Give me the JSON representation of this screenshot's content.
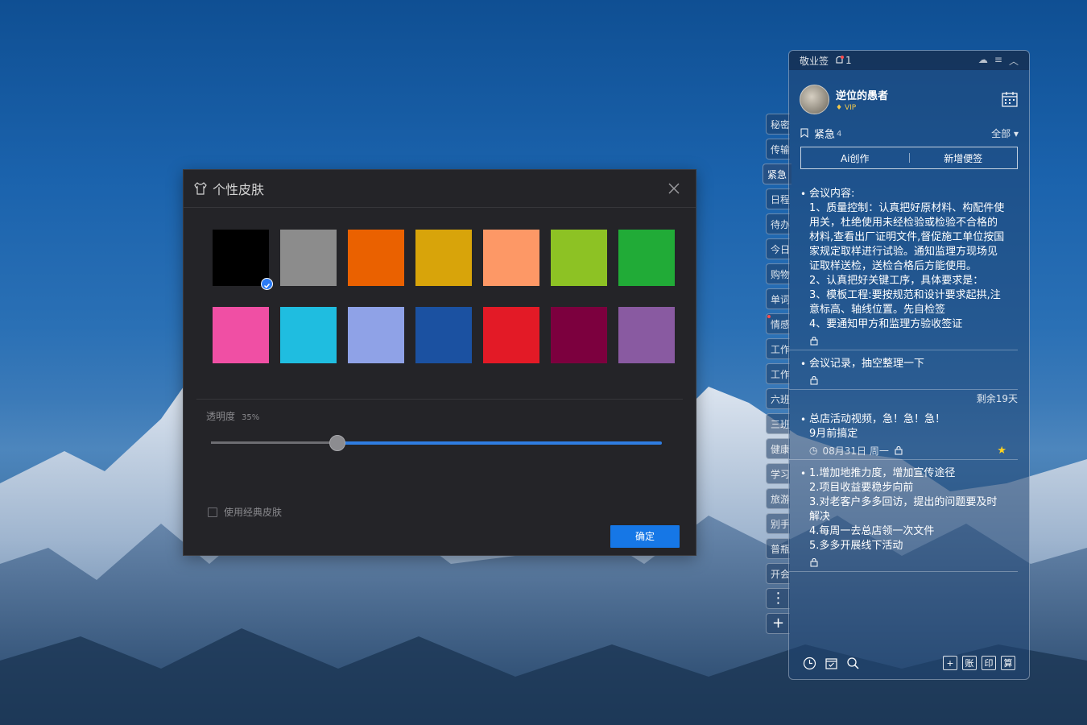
{
  "side_tabs": [
    {
      "label": "秘密",
      "active": false,
      "dot": false
    },
    {
      "label": "传输",
      "active": false,
      "dot": false
    },
    {
      "label": "紧急",
      "active": true,
      "dot": false
    },
    {
      "label": "日程",
      "active": false,
      "dot": false
    },
    {
      "label": "待办",
      "active": false,
      "dot": false
    },
    {
      "label": "今日",
      "active": false,
      "dot": false
    },
    {
      "label": "购物",
      "active": false,
      "dot": false
    },
    {
      "label": "单词",
      "active": false,
      "dot": false
    },
    {
      "label": "情感",
      "active": false,
      "dot": true
    },
    {
      "label": "工作",
      "active": false,
      "dot": false
    },
    {
      "label": "工作",
      "active": false,
      "dot": false
    },
    {
      "label": "六班",
      "active": false,
      "dot": false
    },
    {
      "label": "三班",
      "active": false,
      "dot": false
    },
    {
      "label": "健康",
      "active": false,
      "dot": false
    },
    {
      "label": "学习",
      "active": false,
      "dot": false
    },
    {
      "label": "旅游",
      "active": false,
      "dot": false
    },
    {
      "label": "别手",
      "active": false,
      "dot": false
    },
    {
      "label": "普瓶",
      "active": false,
      "dot": false
    },
    {
      "label": "开会",
      "active": false,
      "dot": false
    }
  ],
  "side_buttons": {
    "more": "⋮",
    "add": "+"
  },
  "panel": {
    "app_name": "敬业签",
    "bell_count": "1",
    "user": {
      "name": "逆位的愚者",
      "vip": "VIP"
    },
    "filter": {
      "label": "紧急",
      "count": "4",
      "all": "全部"
    },
    "actions": {
      "ai": "Ai创作",
      "new": "新增便签"
    },
    "notes": [
      {
        "text": "会议内容:\n1、质量控制：认真把好原材料、构配件使用关，杜绝使用未经检验或检验不合格的材料,查看出厂证明文件,督促施工单位按国家规定取样进行试验。通知监理方现场见证取样送检，送检合格后方能使用。\n2、认真把好关键工序，具体要求是：\n3、模板工程:要按规范和设计要求起拱,注意标高、轴线位置。先自检签\n4、要通知甲方和监理方验收签证",
        "remain": "",
        "date": "",
        "starred": false
      },
      {
        "text": "会议记录，抽空整理一下",
        "remain": "",
        "date": "",
        "starred": false
      },
      {
        "text": "总店活动视频，急！急！急！\n9月前搞定",
        "remain": "剩余19天",
        "date": "08月31日 周一",
        "starred": true
      },
      {
        "text": "1.增加地推力度，增加宣传途径\n2.项目收益要稳步向前\n3.对老客户多多回访，提出的问题要及时解决\n4.每周一去总店领一次文件\n5.多多开展线下活动",
        "remain": "",
        "date": "",
        "starred": false
      }
    ],
    "bottom_right": [
      "+",
      "账",
      "印",
      "算"
    ]
  },
  "dialog": {
    "title": "个性皮肤",
    "swatches": [
      {
        "color": "#000000",
        "selected": true
      },
      {
        "color": "#8c8c8c",
        "selected": false
      },
      {
        "color": "#ea6100",
        "selected": false
      },
      {
        "color": "#d8a40a",
        "selected": false
      },
      {
        "color": "#fd9866",
        "selected": false
      },
      {
        "color": "#8dc224",
        "selected": false
      },
      {
        "color": "#21ab37",
        "selected": false
      },
      {
        "color": "#f04fa4",
        "selected": false
      },
      {
        "color": "#1fbde0",
        "selected": false
      },
      {
        "color": "#8fa2e7",
        "selected": false
      },
      {
        "color": "#1b51a1",
        "selected": false
      },
      {
        "color": "#e31a26",
        "selected": false
      },
      {
        "color": "#7c003e",
        "selected": false
      },
      {
        "color": "#895aa1",
        "selected": false
      }
    ],
    "opacity_label": "透明度",
    "opacity_value_text": "35%",
    "opacity_value": 0.28,
    "classic_label": "使用经典皮肤",
    "ok_label": "确定"
  }
}
